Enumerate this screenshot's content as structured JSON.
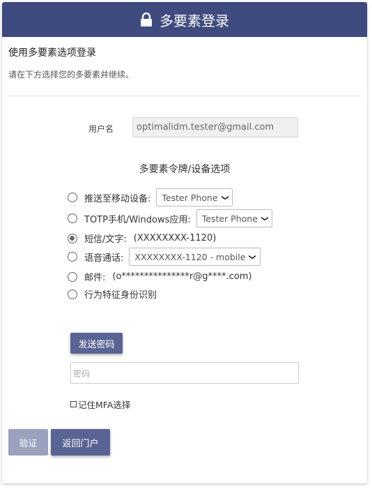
{
  "header": {
    "title": "多要素登录",
    "icon": "lock-icon"
  },
  "section": {
    "title": "使用多要素选项登录",
    "description": "请在下方选择您的多要素并继续。"
  },
  "username": {
    "label": "用户名",
    "value": "optimalidm.tester@gmail.com"
  },
  "options_title": "多要素令牌/设备选项",
  "options": [
    {
      "label": "推送至移动设备:",
      "select": "Tester Phone",
      "checked": false
    },
    {
      "label": "TOTP手机/Windows应用:",
      "select": "Tester Phone",
      "checked": false
    },
    {
      "label": "短信/文字:",
      "value": "(XXXXXXXX-1120)",
      "checked": true
    },
    {
      "label": "语音通话:",
      "select": "XXXXXXXX-1120 - mobile",
      "checked": false
    },
    {
      "label": "邮件:",
      "value": "(o***************r@g****.com)",
      "checked": false
    },
    {
      "label": "行为特征身份识别",
      "checked": false
    }
  ],
  "send_button": "发送密码",
  "password": {
    "placeholder": "密码",
    "value": ""
  },
  "remember": {
    "label": "记住MFA选择",
    "checked": false
  },
  "buttons": {
    "verify": "验证",
    "back": "返回门户"
  },
  "colors": {
    "header_bg": "#3f4a7e",
    "primary_button": "#5a6494",
    "disabled_button": "#9aa1bd"
  }
}
